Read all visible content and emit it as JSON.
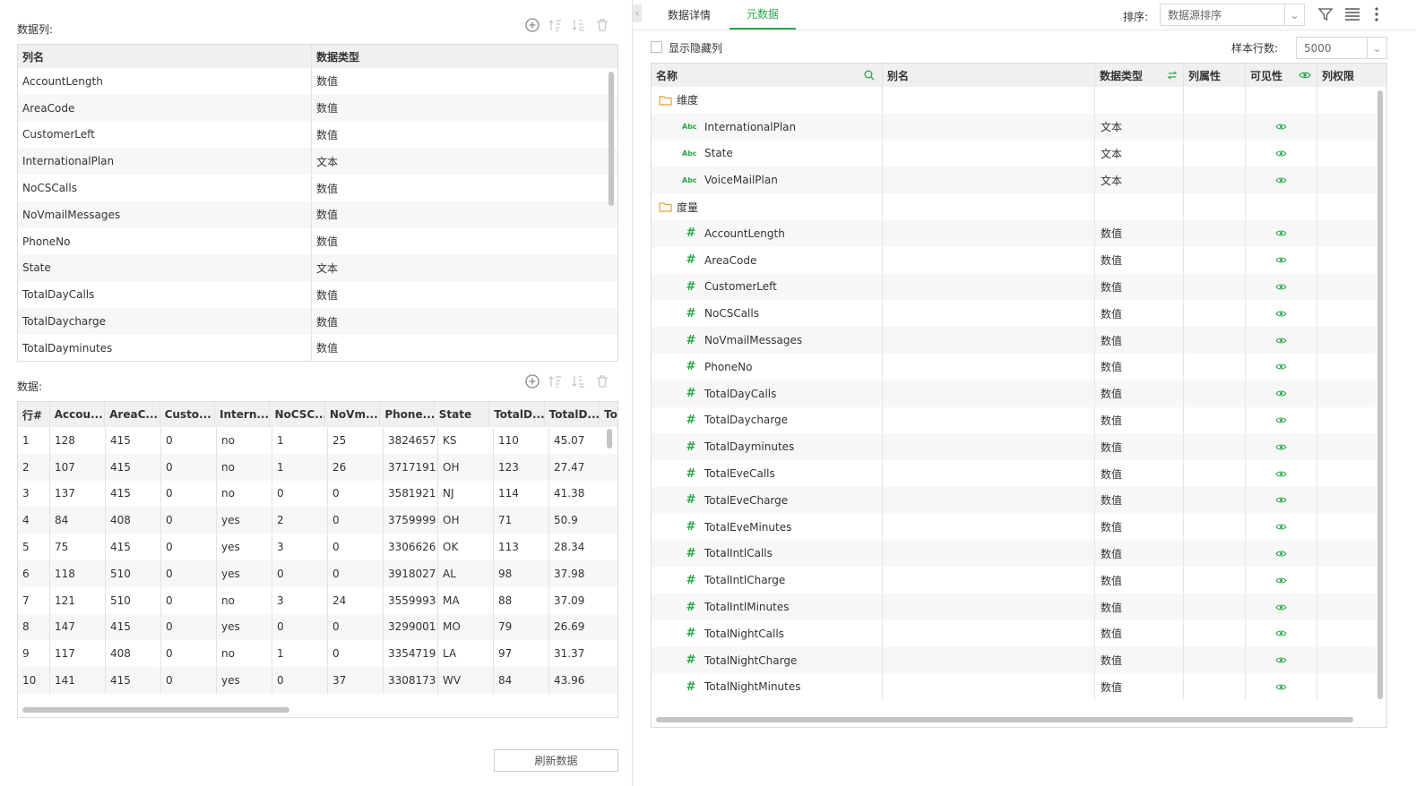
{
  "left": {
    "columns_title": "数据列:",
    "columns_table": {
      "headers": [
        "列名",
        "数据类型"
      ],
      "rows": [
        [
          "AccountLength",
          "数值"
        ],
        [
          "AreaCode",
          "数值"
        ],
        [
          "CustomerLeft",
          "数值"
        ],
        [
          "InternationalPlan",
          "文本"
        ],
        [
          "NoCSCalls",
          "数值"
        ],
        [
          "NoVmailMessages",
          "数值"
        ],
        [
          "PhoneNo",
          "数值"
        ],
        [
          "State",
          "文本"
        ],
        [
          "TotalDayCalls",
          "数值"
        ],
        [
          "TotalDaycharge",
          "数值"
        ],
        [
          "TotalDayminutes",
          "数值"
        ]
      ]
    },
    "data_title": "数据:",
    "data_table": {
      "headers": [
        "行#",
        "Accou...",
        "AreaC...",
        "Custo...",
        "Intern...",
        "NoCSC...",
        "NoVm...",
        "Phone...",
        "State",
        "TotalD...",
        "TotalD...",
        "To"
      ],
      "rows": [
        [
          "1",
          "128",
          "415",
          "0",
          "no",
          "1",
          "25",
          "3824657",
          "KS",
          "110",
          "45.07"
        ],
        [
          "2",
          "107",
          "415",
          "0",
          "no",
          "1",
          "26",
          "3717191",
          "OH",
          "123",
          "27.47"
        ],
        [
          "3",
          "137",
          "415",
          "0",
          "no",
          "0",
          "0",
          "3581921",
          "NJ",
          "114",
          "41.38"
        ],
        [
          "4",
          "84",
          "408",
          "0",
          "yes",
          "2",
          "0",
          "3759999",
          "OH",
          "71",
          "50.9"
        ],
        [
          "5",
          "75",
          "415",
          "0",
          "yes",
          "3",
          "0",
          "3306626",
          "OK",
          "113",
          "28.34"
        ],
        [
          "6",
          "118",
          "510",
          "0",
          "yes",
          "0",
          "0",
          "3918027",
          "AL",
          "98",
          "37.98"
        ],
        [
          "7",
          "121",
          "510",
          "0",
          "no",
          "3",
          "24",
          "3559993",
          "MA",
          "88",
          "37.09"
        ],
        [
          "8",
          "147",
          "415",
          "0",
          "yes",
          "0",
          "0",
          "3299001",
          "MO",
          "79",
          "26.69"
        ],
        [
          "9",
          "117",
          "408",
          "0",
          "no",
          "1",
          "0",
          "3354719",
          "LA",
          "97",
          "31.37"
        ],
        [
          "10",
          "141",
          "415",
          "0",
          "yes",
          "0",
          "37",
          "3308173",
          "WV",
          "84",
          "43.96"
        ]
      ]
    },
    "refresh_label": "刷新数据"
  },
  "right": {
    "tabs": [
      {
        "label": "数据详情",
        "active": false
      },
      {
        "label": "元数据",
        "active": true
      }
    ],
    "sort_label": "排序:",
    "sort_value": "数据源排序",
    "show_hidden_label": "显示隐藏列",
    "sample_label": "样本行数:",
    "sample_value": "5000",
    "meta_headers": {
      "name": "名称",
      "alias": "别名",
      "type": "数据类型",
      "attr": "列属性",
      "visible": "可见性",
      "perm": "列权限"
    },
    "groups": [
      {
        "label": "维度",
        "icon": "folder-icon",
        "items": [
          {
            "name": "InternationalPlan",
            "type": "文本",
            "kind": "Abc"
          },
          {
            "name": "State",
            "type": "文本",
            "kind": "Abc"
          },
          {
            "name": "VoiceMailPlan",
            "type": "文本",
            "kind": "Abc"
          }
        ]
      },
      {
        "label": "度量",
        "icon": "folder-icon",
        "items": [
          {
            "name": "AccountLength",
            "type": "数值",
            "kind": "#"
          },
          {
            "name": "AreaCode",
            "type": "数值",
            "kind": "#"
          },
          {
            "name": "CustomerLeft",
            "type": "数值",
            "kind": "#"
          },
          {
            "name": "NoCSCalls",
            "type": "数值",
            "kind": "#"
          },
          {
            "name": "NoVmailMessages",
            "type": "数值",
            "kind": "#"
          },
          {
            "name": "PhoneNo",
            "type": "数值",
            "kind": "#"
          },
          {
            "name": "TotalDayCalls",
            "type": "数值",
            "kind": "#"
          },
          {
            "name": "TotalDaycharge",
            "type": "数值",
            "kind": "#"
          },
          {
            "name": "TotalDayminutes",
            "type": "数值",
            "kind": "#"
          },
          {
            "name": "TotalEveCalls",
            "type": "数值",
            "kind": "#"
          },
          {
            "name": "TotalEveCharge",
            "type": "数值",
            "kind": "#"
          },
          {
            "name": "TotalEveMinutes",
            "type": "数值",
            "kind": "#"
          },
          {
            "name": "TotalIntlCalls",
            "type": "数值",
            "kind": "#"
          },
          {
            "name": "TotalIntlCharge",
            "type": "数值",
            "kind": "#"
          },
          {
            "name": "TotalIntlMinutes",
            "type": "数值",
            "kind": "#"
          },
          {
            "name": "TotalNightCalls",
            "type": "数值",
            "kind": "#"
          },
          {
            "name": "TotalNightCharge",
            "type": "数值",
            "kind": "#"
          },
          {
            "name": "TotalNightMinutes",
            "type": "数值",
            "kind": "#"
          }
        ]
      }
    ],
    "accent_color": "#2aa64a"
  }
}
